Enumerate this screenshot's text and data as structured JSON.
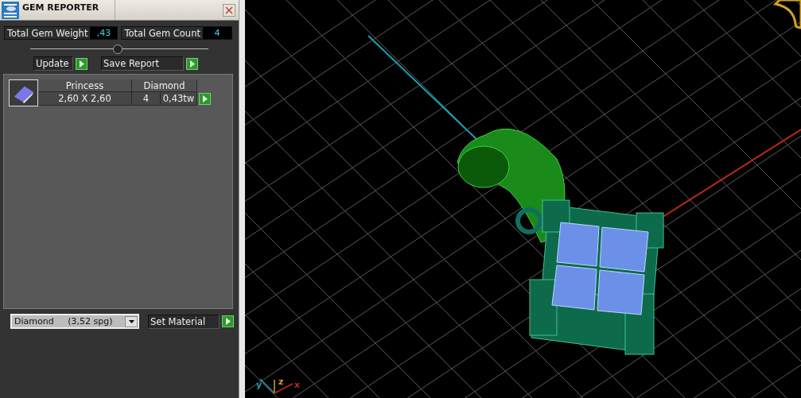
{
  "panel": {
    "title": "GEM REPORTER",
    "totals": [
      {
        "label": "Total Gem Weight",
        "value": ",43"
      },
      {
        "label": "Total Gem Count",
        "value": "4"
      }
    ],
    "actions": [
      "Update",
      "Save Report"
    ],
    "gems": [
      {
        "cut": "Princess",
        "material": "Diamond",
        "size": "2,60 X 2,60",
        "count": "4",
        "weight": "0,43tw"
      }
    ],
    "material_select": {
      "value": "Diamond     (3,52 spg)"
    },
    "set_material": "Set Material"
  },
  "viewport": {
    "axis_labels": [
      {
        "axis": "y",
        "color": "#1aa0b0"
      },
      {
        "axis": "z",
        "color": "#d4a020"
      },
      {
        "axis": "x",
        "color": "#c02818"
      }
    ]
  }
}
